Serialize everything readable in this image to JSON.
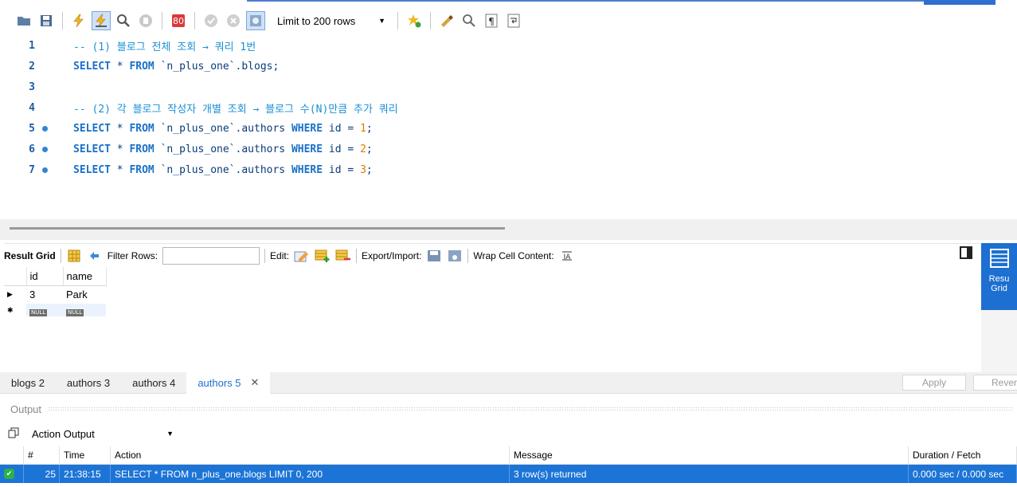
{
  "toolbar": {
    "limit_select": "Limit to 200 rows",
    "icons": [
      "open-folder-icon",
      "save-icon",
      "execute-icon",
      "execute-current-icon",
      "explain-icon",
      "stop-icon",
      "toggle-error-icon",
      "commit-icon",
      "rollback-icon",
      "autocommit-icon",
      "add-snippet-icon",
      "beautify-icon",
      "find-icon",
      "invisible-chars-icon",
      "wrap-icon"
    ]
  },
  "editor": {
    "lines": [
      {
        "num": "1",
        "comment": "-- (1) 블로그 전체 조회 → 쿼리 1번"
      },
      {
        "num": "2",
        "kw1": "SELECT",
        "t1": " * ",
        "kw2": "FROM",
        "t2": " `n_plus_one`.blogs;"
      },
      {
        "num": "3"
      },
      {
        "num": "4",
        "comment": "-- (2) 각 블로그 작성자 개별 조회 → 블로그 수(N)만큼 추가 쿼리"
      },
      {
        "num": "5",
        "kw1": "SELECT",
        "t1": " * ",
        "kw2": "FROM",
        "t2": " `n_plus_one`.authors ",
        "kw3": "WHERE",
        "t3": " id = ",
        "val": "1",
        "end": ";"
      },
      {
        "num": "6",
        "kw1": "SELECT",
        "t1": " * ",
        "kw2": "FROM",
        "t2": " `n_plus_one`.authors ",
        "kw3": "WHERE",
        "t3": " id = ",
        "val": "2",
        "end": ";"
      },
      {
        "num": "7",
        "kw1": "SELECT",
        "t1": " * ",
        "kw2": "FROM",
        "t2": " `n_plus_one`.authors ",
        "kw3": "WHERE",
        "t3": " id = ",
        "val": "3",
        "end": ";"
      }
    ]
  },
  "result_toolbar": {
    "result_grid": "Result Grid",
    "filter_rows": "Filter Rows:",
    "edit": "Edit:",
    "export_import": "Export/Import:",
    "wrap_cell": "Wrap Cell Content:"
  },
  "side_panel": {
    "label": "Resu Grid"
  },
  "grid": {
    "columns": [
      "id",
      "name"
    ],
    "rows": [
      [
        "3",
        "Park"
      ]
    ],
    "new_row": [
      "NULL",
      "NULL"
    ]
  },
  "tabs": {
    "items": [
      "blogs 2",
      "authors 3",
      "authors 4",
      "authors 5"
    ],
    "active_index": 3,
    "apply": "Apply",
    "revert": "Rever"
  },
  "output": {
    "title": "Output",
    "selector": "Action Output",
    "columns": [
      "#",
      "Time",
      "Action",
      "Message",
      "Duration / Fetch"
    ],
    "rows": [
      {
        "num": "25",
        "time": "21:38:15",
        "action": "SELECT * FROM n_plus_one.blogs LIMIT 0, 200",
        "message": "3 row(s) returned",
        "duration": "0.000 sec / 0.000 sec",
        "status": "ok"
      }
    ]
  },
  "colors": {
    "accent": "#1c74d6",
    "keyword": "#1a70c9",
    "number": "#e07b00",
    "ok": "#2bb14a"
  }
}
